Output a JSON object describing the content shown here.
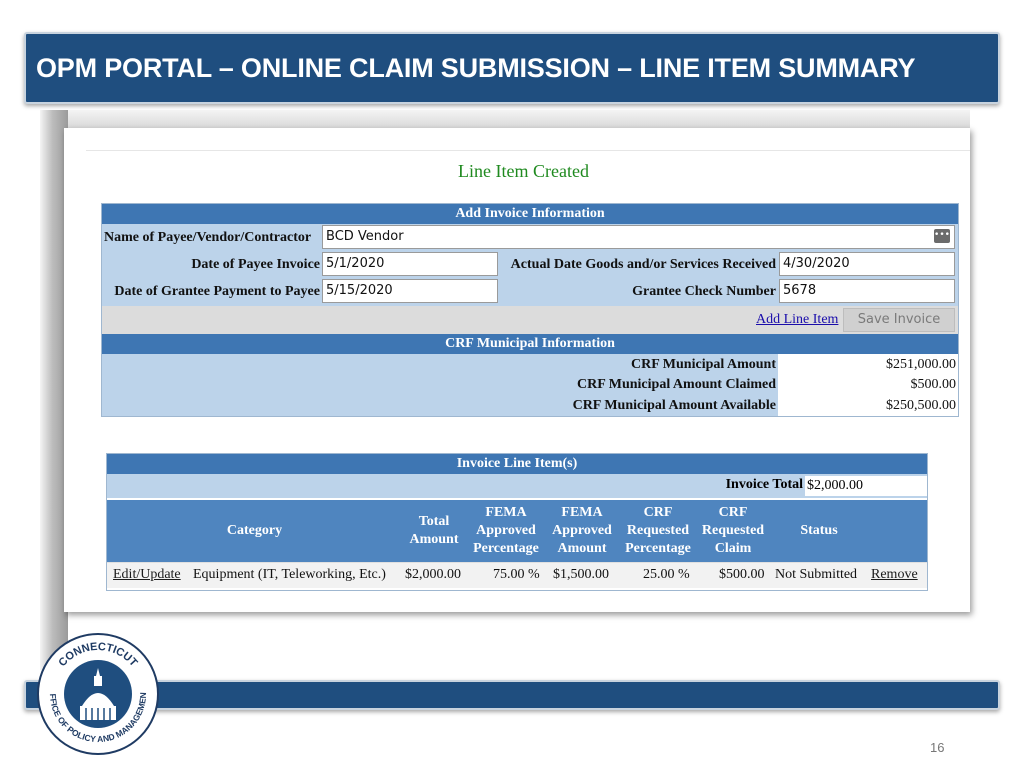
{
  "slide": {
    "title": "OPM PORTAL – ONLINE CLAIM SUBMISSION – LINE ITEM SUMMARY",
    "page_number": "16"
  },
  "colors": {
    "banner": "#1f4e7f",
    "band": "#3e76b3",
    "panel": "#bcd3ea",
    "success": "#1f8a1f"
  },
  "screen": {
    "created_message": "Line Item Created",
    "invoice": {
      "section_title": "Add Invoice Information",
      "payee_label": "Name of Payee/Vendor/Contractor",
      "payee_value": "BCD Vendor",
      "invoice_date_label": "Date of Payee Invoice",
      "invoice_date_value": "5/1/2020",
      "goods_date_label": "Actual Date Goods and/or Services Received",
      "goods_date_value": "4/30/2020",
      "payment_date_label": "Date of Grantee Payment to Payee",
      "payment_date_value": "5/15/2020",
      "check_label": "Grantee Check Number",
      "check_value": "5678",
      "add_line_item": "Add Line Item",
      "save_invoice": "Save Invoice",
      "lookup_icon": "ellipsis-icon"
    },
    "crf": {
      "section_title": "CRF Municipal Information",
      "amount_label": "CRF Municipal Amount",
      "amount_value": "$251,000.00",
      "claimed_label": "CRF Municipal Amount Claimed",
      "claimed_value": "$500.00",
      "available_label": "CRF Municipal Amount Available",
      "available_value": "$250,500.00"
    },
    "line_items": {
      "section_title": "Invoice Line Item(s)",
      "total_label": "Invoice Total",
      "total_value": "$2,000.00",
      "columns": {
        "category": "Category",
        "total_amount": "Total Amount",
        "fema_pct": "FEMA Approved Percentage",
        "fema_amt": "FEMA Approved Amount",
        "crf_pct": "CRF Requested Percentage",
        "crf_claim": "CRF Requested Claim",
        "status": "Status"
      },
      "rows": [
        {
          "edit": "Edit/Update",
          "category": "Equipment (IT, Teleworking, Etc.)",
          "total_amount": "$2,000.00",
          "fema_pct": "75.00 %",
          "fema_amt": "$1,500.00",
          "crf_pct": "25.00 %",
          "crf_claim": "$500.00",
          "status": "Not Submitted",
          "remove": "Remove"
        }
      ]
    }
  },
  "logo": {
    "text_top": "CONNECTICUT",
    "text_bottom": "OFFICE OF POLICY AND MANAGEMENT"
  }
}
